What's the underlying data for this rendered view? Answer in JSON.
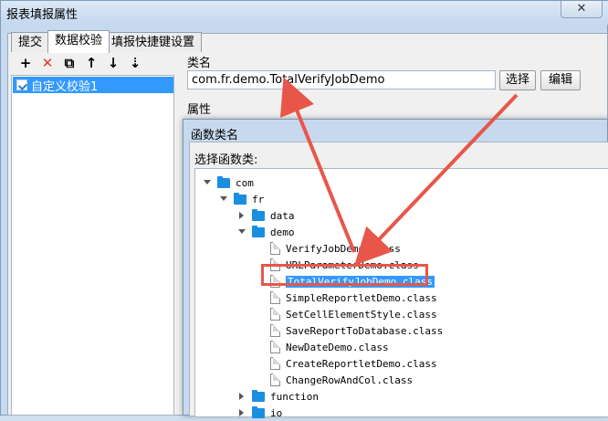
{
  "window": {
    "title": "报表填报属性",
    "close_glyph": "✕"
  },
  "tabs": [
    {
      "label": "提交"
    },
    {
      "label": "数据校验"
    },
    {
      "label": "填报快捷键设置"
    }
  ],
  "toolbar": {
    "add_glyph": "+",
    "delete_glyph": "✕",
    "copy_glyph": "⧉",
    "up_glyph": "↑",
    "down_glyph": "↓",
    "sort_glyph": "⇣"
  },
  "rules": [
    {
      "label": "自定义校验1"
    }
  ],
  "form": {
    "classname_label": "类名",
    "classname_value": "com.fr.demo.TotalVerifyJobDemo",
    "select_button": "选择",
    "edit_button": "编辑",
    "properties_label": "属性"
  },
  "dialog": {
    "title": "函数类名",
    "prompt": "选择函数类:",
    "tree": {
      "com": "com",
      "fr": "fr",
      "data": "data",
      "demo": "demo",
      "files": [
        "VerifyJobDemo.class",
        "URLParameterDemo.class",
        "TotalVerifyJobDemo.class",
        "SimpleReportletDemo.class",
        "SetCellElementStyle.class",
        "SaveReportToDatabase.class",
        "NewDateDemo.class",
        "CreateReportletDemo.class",
        "ChangeRowAndCol.class"
      ],
      "function": "function",
      "io": "io"
    }
  },
  "colors": {
    "selection": "#3399ff",
    "annotation": "#e8564a",
    "folder": "#1a8fe0"
  }
}
